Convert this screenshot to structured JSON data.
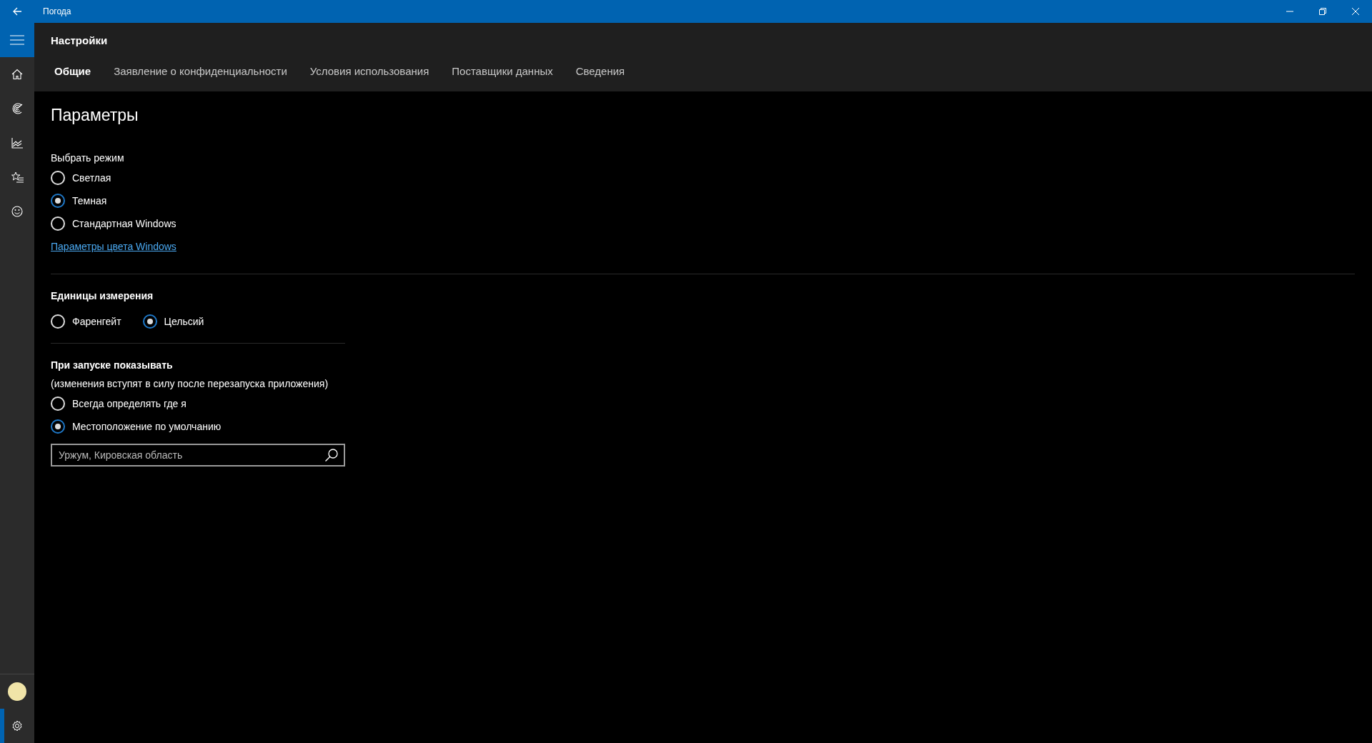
{
  "window": {
    "title": "Погода"
  },
  "nav": {
    "top": [
      {
        "kind": "home",
        "selected": false
      },
      {
        "kind": "forecast",
        "selected": false
      },
      {
        "kind": "charts",
        "selected": false
      },
      {
        "kind": "favorites",
        "selected": false
      },
      {
        "kind": "smiley",
        "selected": false
      }
    ],
    "bottom": [
      {
        "kind": "avatar",
        "selected": false
      },
      {
        "kind": "settings",
        "selected": true
      }
    ]
  },
  "header": {
    "title": "Настройки"
  },
  "tabs": [
    {
      "label": "Общие",
      "selected": true
    },
    {
      "label": "Заявление о конфиденциальности",
      "selected": false
    },
    {
      "label": "Условия использования",
      "selected": false
    },
    {
      "label": "Поставщики данных",
      "selected": false
    },
    {
      "label": "Сведения",
      "selected": false
    }
  ],
  "page": {
    "heading": "Параметры"
  },
  "mode": {
    "label": "Выбрать режим",
    "options": [
      {
        "label": "Светлая",
        "selected": false
      },
      {
        "label": "Темная",
        "selected": true
      },
      {
        "label": "Стандартная Windows",
        "selected": false
      }
    ],
    "link": "Параметры цвета Windows"
  },
  "units": {
    "label": "Единицы измерения",
    "options": [
      {
        "label": "Фаренгейт",
        "selected": false
      },
      {
        "label": "Цельсий",
        "selected": true
      }
    ]
  },
  "startup": {
    "label": "При запуске показывать",
    "note": "(изменения вступят в силу после перезапуска приложения)",
    "options": [
      {
        "label": "Всегда определять где я",
        "selected": false
      },
      {
        "label": "Местоположение по умолчанию",
        "selected": true
      }
    ],
    "location": {
      "value": "Уржум, Кировская область"
    }
  }
}
